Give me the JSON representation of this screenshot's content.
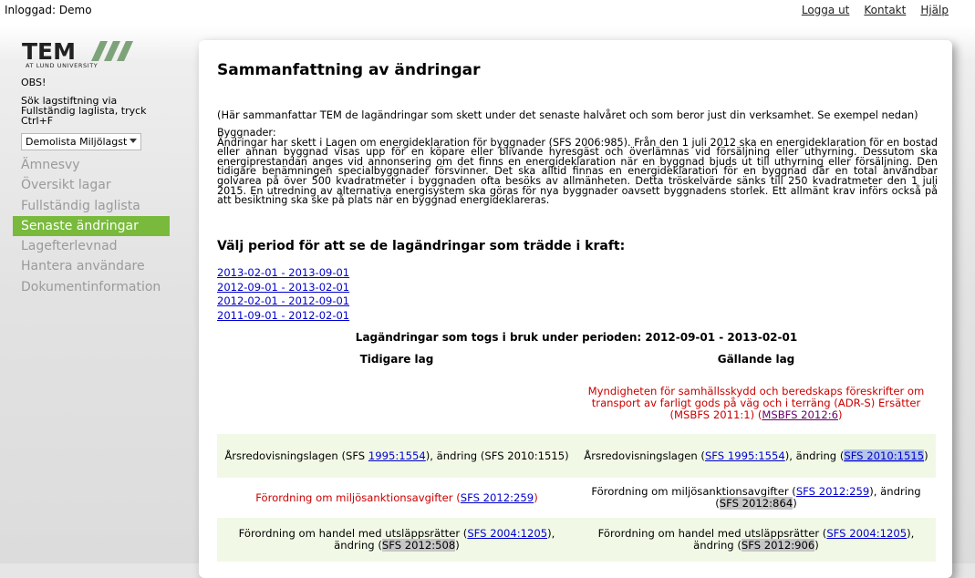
{
  "header": {
    "user": "Inloggad: Demo",
    "links": [
      "Logga ut",
      "Kontakt",
      "Hjälp"
    ]
  },
  "sidebar": {
    "logo": {
      "text": "TEM",
      "subtitle": "AT LUND UNIVERSITY"
    },
    "obs": "OBS!",
    "hint": "Sök lagstiftning via Fullständig laglista, tryck Ctrl+F",
    "list_select": "Demolista Miljölagstiftning",
    "nav": [
      "Ämnesvy",
      "Översikt lagar",
      "Fullständig laglista",
      "Senaste ändringar",
      "Lagefterlevnad",
      "Hantera användare",
      "Dokumentinformation"
    ],
    "active_index": 3
  },
  "main": {
    "title": "Sammanfattning av ändringar",
    "intro": "(Här sammanfattar TEM de lagändringar som skett under det senaste halvåret och som beror just din verksamhet. Se exempel nedan)",
    "byggnader_label": "Byggnader:",
    "byggnader_text": "Ändringar har skett i Lagen om energideklaration för byggnader (SFS 2006:985). Från den 1 juli 2012 ska en energideklaration för en bostad eller annan byggnad visas upp för en köpare eller blivande hyresgäst och överlämnas vid försäljning eller uthyrning. Dessutom ska energiprestandan anges vid annonsering om det finns en energideklaration när en byggnad bjuds ut till uthyrning eller försäljning. Den tidigare benämningen specialbyggnader försvinner. Det ska alltid finnas en energideklaration för en byggnad där en total användbar golvarea på över 500 kvadratmeter i byggnaden ofta besöks av allmänheten. Detta tröskelvärde sänks till 250 kvadratmeter den 1 juli 2015. En utredning av alternativa energisystem ska göras för nya byggnader oavsett byggnadens storlek. Ett allmänt krav införs också på att besiktning ska ske på plats när en byggnad energideklareras.",
    "period_heading": "Välj period för att se de lagändringar som trädde i kraft:",
    "periods": [
      "2013-02-01 - 2013-09-01",
      "2012-09-01 - 2013-02-01",
      "2012-02-01 - 2012-09-01",
      "2011-09-01 - 2012-02-01"
    ],
    "table_title": "Lagändringar som togs i bruk under perioden: 2012-09-01 - 2013-02-01",
    "col_prev": "Tidigare lag",
    "col_curr": "Gällande lag",
    "rows": {
      "r1": {
        "curr_text": "Myndigheten för samhällsskydd och beredskaps föreskrifter om transport av farligt gods på väg och i terräng (ADR-S) Ersätter (MSBFS 2011:1) (",
        "curr_link": "MSBFS 2012:6",
        "curr_end": ")"
      },
      "r2": {
        "prev_a": "Årsredovisningslagen (SFS ",
        "prev_link": "1995:1554",
        "prev_b": "), ändring (SFS 2010:1515)",
        "curr_a": "Årsredovisningslagen (",
        "curr_link": "SFS 1995:1554",
        "curr_b": "), ändring (",
        "curr_hl": "SFS 2010:1515",
        "curr_c": ")"
      },
      "r3": {
        "prev_a": "Förordning om miljösanktionsavgifter (",
        "prev_link": "SFS 2012:259",
        "prev_b": ")",
        "curr_a": "Förordning om miljösanktionsavgifter (",
        "curr_link": "SFS 2012:259",
        "curr_b": "), ändring (",
        "curr_gray": "SFS 2012:864",
        "curr_c": ")"
      },
      "r4": {
        "prev_a": "Förordning om handel med utsläppsrätter (",
        "prev_link": "SFS 2004:1205",
        "prev_b": "), ändring (",
        "prev_gray": "SFS 2012:508",
        "prev_c": ")",
        "curr_a": "Förordning om handel med utsläppsrätter (",
        "curr_link": "SFS 2004:1205",
        "curr_b": "), ändring (",
        "curr_gray": "SFS 2012:906",
        "curr_c": ")"
      }
    }
  },
  "colors": {
    "nav_active": "#79ba3c",
    "row_green": "#f1f9e6",
    "red_text": "#cc0000",
    "link": "#0000cc"
  }
}
